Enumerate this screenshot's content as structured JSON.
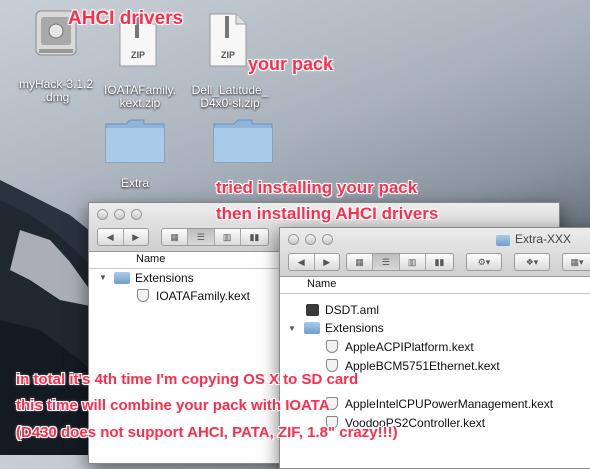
{
  "desktop": {
    "icons": [
      {
        "label": "myHack-3.1.2\n.dmg",
        "kind": "dmg"
      },
      {
        "label": "IOATAFamily.\nkext.zip",
        "kind": "zip",
        "badge": "ZIP"
      },
      {
        "label": "Dell_Latitude_\nD4x0-sl.zip",
        "kind": "zip",
        "badge": "ZIP"
      },
      {
        "label": "Extra",
        "kind": "folder"
      }
    ]
  },
  "annotations": {
    "ahci_drivers": "AHCI drivers",
    "your_pack": "your pack",
    "tried_1": "tried installing your pack",
    "tried_2": "then installing AHCI drivers",
    "bottom_1": "in total it's 4th time I'm copying OS X to SD card",
    "bottom_2": "this time will combine your pack with IOATA",
    "bottom_3": "(D430 does not support AHCI, PATA, ZIF, 1.8\" crazy!!!)"
  },
  "window_back": {
    "column_header": "Name",
    "rows": [
      {
        "name": "Extensions",
        "kind": "folder"
      },
      {
        "name": "IOATAFamily.kext",
        "kind": "kext"
      }
    ]
  },
  "window_front": {
    "title": "Extra-XXX",
    "column_header": "Name",
    "rows": [
      {
        "name": "DSDT.aml",
        "kind": "aml"
      },
      {
        "name": "Extensions",
        "kind": "folder"
      },
      {
        "name": "AppleACPIPlatform.kext",
        "kind": "kext"
      },
      {
        "name": "AppleBCM5751Ethernet.kext",
        "kind": "kext"
      },
      {
        "name": "AppleIntelCPUPowerManagement.kext",
        "kind": "kext"
      },
      {
        "name": "VoodooPS2Controller.kext",
        "kind": "kext"
      }
    ]
  },
  "colors": {
    "annotation": "#ff2d4a"
  }
}
